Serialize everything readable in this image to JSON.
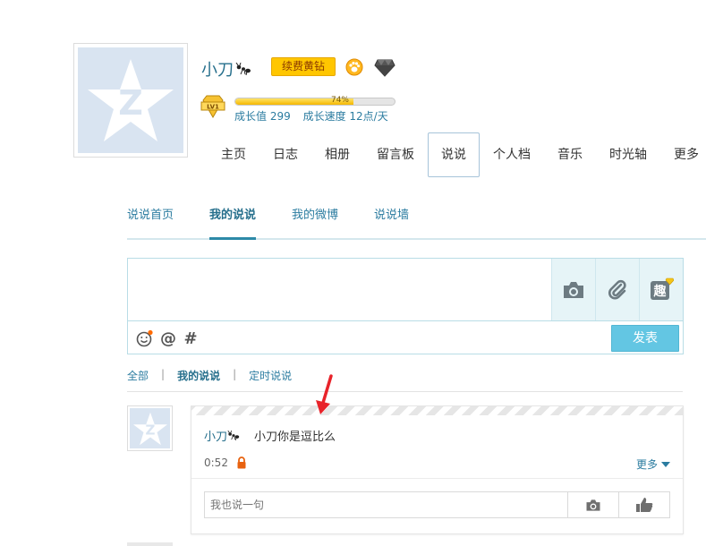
{
  "profile": {
    "name": "小刀",
    "vip_label": "续费黄钻",
    "progress_percent": 74,
    "progress_text": "74%",
    "growth_value": "成长值 299",
    "growth_speed": "成长速度 12点/天",
    "level_badge": "LV1"
  },
  "nav": {
    "items": [
      {
        "label": "主页"
      },
      {
        "label": "日志"
      },
      {
        "label": "相册"
      },
      {
        "label": "留言板"
      },
      {
        "label": "说说"
      },
      {
        "label": "个人档"
      },
      {
        "label": "音乐"
      },
      {
        "label": "时光轴"
      },
      {
        "label": "更多"
      }
    ],
    "active_index": 4
  },
  "sub_tabs": {
    "items": [
      {
        "label": "说说首页"
      },
      {
        "label": "我的说说"
      },
      {
        "label": "我的微博"
      },
      {
        "label": "说说墙"
      }
    ],
    "active_index": 1
  },
  "composer": {
    "placeholder": "",
    "submit_label": "发表",
    "tools": [
      "camera-icon",
      "attachment-icon",
      "fun-icon"
    ],
    "fun_label": "趣",
    "bottom_icons": [
      "emoji-icon",
      "mention-icon",
      "hashtag-icon"
    ],
    "mention_symbol": "@",
    "hashtag_symbol": "#"
  },
  "filters": {
    "items": [
      {
        "label": "全部"
      },
      {
        "label": "我的说说"
      },
      {
        "label": "定时说说"
      }
    ],
    "active_index": 1,
    "separator": "|"
  },
  "feed": {
    "author": "小刀",
    "content": "小刀你是逗比么",
    "time": "0:52",
    "more_label": "更多",
    "reply_placeholder": "我也说一句"
  },
  "colors": {
    "accent": "#2b7ca0",
    "vip": "#ffc600",
    "submit": "#63c6e3",
    "annotation_arrow": "#e8232a"
  }
}
